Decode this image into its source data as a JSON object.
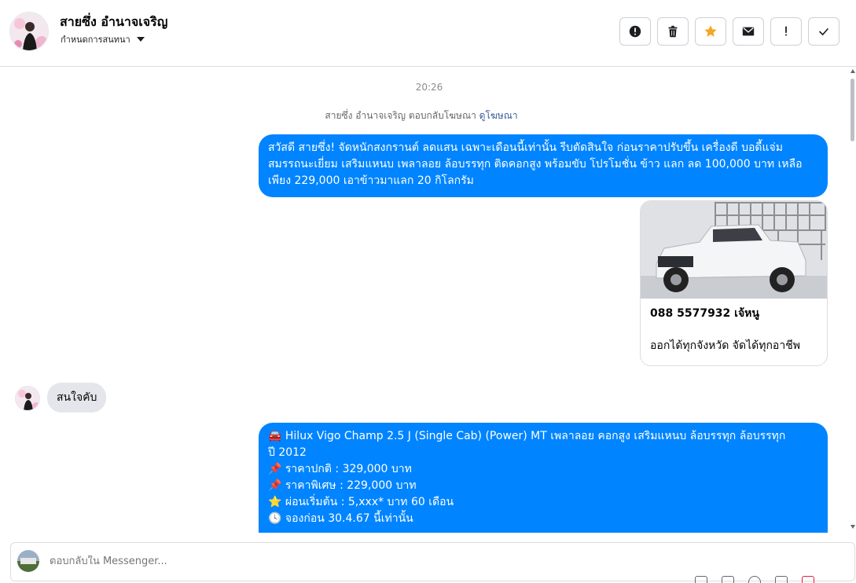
{
  "header": {
    "contact_name": "สายซึ่ง อำนาจเจริญ",
    "conversation_settings": "กำหนดการสนทนา",
    "actions": [
      {
        "name": "report-spam-button",
        "icon": "alert-circle-icon"
      },
      {
        "name": "delete-button",
        "icon": "trash-icon"
      },
      {
        "name": "star-button",
        "icon": "star-icon"
      },
      {
        "name": "mark-unread-button",
        "icon": "envelope-icon"
      },
      {
        "name": "mark-important-button",
        "icon": "exclamation-icon"
      },
      {
        "name": "mark-done-button",
        "icon": "check-icon"
      }
    ]
  },
  "chat": {
    "timestamp": "20:26",
    "ad_reply_text": "สายซึ่ง อำนาจเจริญ ตอบกลับโฆษณา",
    "ad_reply_link": "ดูโฆษณา",
    "message_1": "สวัสดี สายซึ่ง! จัดหนักสงกรานต์ ลดแสน เฉพาะเดือนนี้เท่านั้น รีบตัดสินใจ ก่อนราคาปรับขึ้น เครื่องดี บอดี้แจ่ม สมรรถนะเยี่ยม เสริมแหนบ เพลาลอย ล้อบรรทุก ติดคอกสูง พร้อมขับ โปรโมชั่น ข้าว แลก ลด 100,000 บาท เหลือเพียง 229,000 เอาข้าวมาแลก 20 กิโลกรัม",
    "ad_card": {
      "title": "088 5577932 เจ้หนู",
      "description": "ออกได้ทุกจังหวัด จัดได้ทุกอาชีพ"
    },
    "reply_in": "สนใจคับ",
    "message_2_lines": [
      {
        "emoji": "🚘",
        "text": "Hilux Vigo Champ 2.5 J (Single Cab) (Power) MT เพลาลอย คอกสูง เสริมแหนบ ล้อบรรทุก ล้อบรรทุก"
      },
      {
        "emoji": "",
        "text": "ปี 2012"
      },
      {
        "emoji": "📌",
        "text": "ราคาปกติ : 329,000 บาท"
      },
      {
        "emoji": "📌",
        "text": "ราคาพิเศษ : 229,000 บาท"
      },
      {
        "emoji": "⭐",
        "text": "ผ่อนเริ่มต้น : 5,xxx* บาท 60 เดือน"
      },
      {
        "emoji": "🕓",
        "text": "จองก่อน 30.4.67 นี้เท่านั้น"
      }
    ]
  },
  "composer": {
    "placeholder": "ตอบกลับใน Messenger..."
  },
  "colors": {
    "outgoing_bubble": "#0084ff",
    "incoming_bubble": "#e4e6eb",
    "star_active": "#f5a623",
    "link": "#385898"
  }
}
